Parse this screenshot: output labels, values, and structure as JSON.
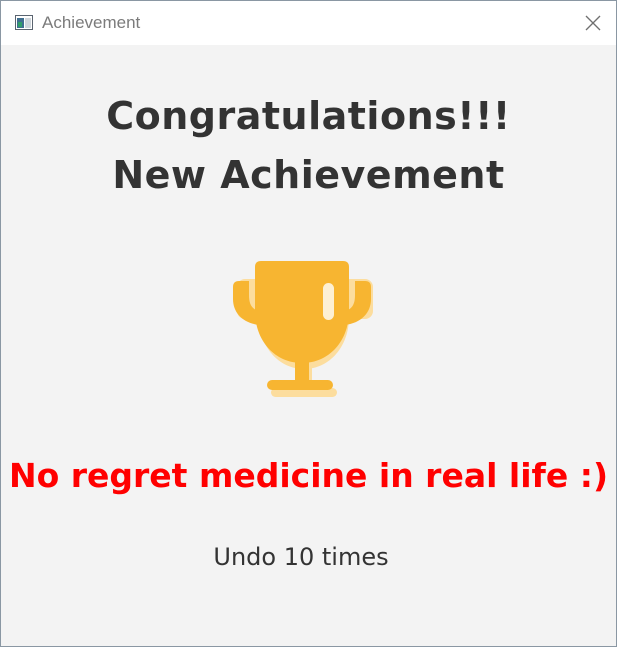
{
  "window": {
    "title": "Achievement",
    "icon": "app-window-icon",
    "close_icon": "close-icon"
  },
  "achievement": {
    "heading_line1": "Congratulations!!!",
    "heading_line2": "New Achievement",
    "badge_icon": "trophy-icon",
    "name": "No regret medicine in real life :)",
    "description": "Undo 10 times"
  },
  "colors": {
    "trophy": "#f7b531",
    "trophy_shadow": "#fcdd9e",
    "achievement_name": "#ff0000",
    "text": "#333333",
    "background": "#f3f3f3",
    "titlebar": "#ffffff"
  }
}
